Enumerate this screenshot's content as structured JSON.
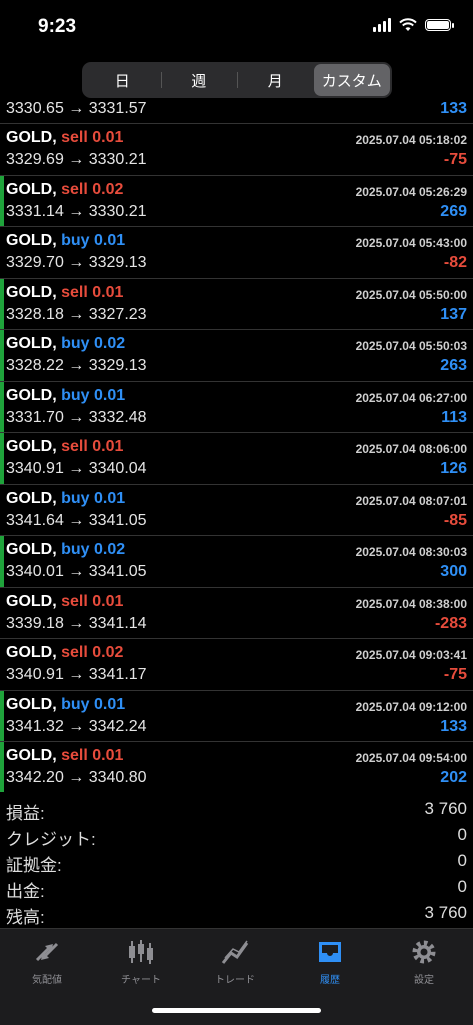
{
  "status_bar": {
    "time": "9:23"
  },
  "period_tabs": [
    {
      "label": "日",
      "active": false
    },
    {
      "label": "週",
      "active": false
    },
    {
      "label": "月",
      "active": false
    },
    {
      "label": "カスタム",
      "active": true
    }
  ],
  "trades_partial": {
    "prices": "3330.65 → 3331.57",
    "profit": "133"
  },
  "trades": [
    {
      "symbol": "GOLD,",
      "side": "sell",
      "action": "sell 0.01",
      "date": "2025.07.04 05:18:02",
      "prices": "3329.69 → 3330.21",
      "profit": "-75"
    },
    {
      "symbol": "GOLD,",
      "side": "sell",
      "action": "sell 0.02",
      "date": "2025.07.04 05:26:29",
      "prices": "3331.14 → 3330.21",
      "profit": "269"
    },
    {
      "symbol": "GOLD,",
      "side": "buy",
      "action": "buy 0.01",
      "date": "2025.07.04 05:43:00",
      "prices": "3329.70 → 3329.13",
      "profit": "-82"
    },
    {
      "symbol": "GOLD,",
      "side": "sell",
      "action": "sell 0.01",
      "date": "2025.07.04 05:50:00",
      "prices": "3328.18 → 3327.23",
      "profit": "137"
    },
    {
      "symbol": "GOLD,",
      "side": "buy",
      "action": "buy 0.02",
      "date": "2025.07.04 05:50:03",
      "prices": "3328.22 → 3329.13",
      "profit": "263"
    },
    {
      "symbol": "GOLD,",
      "side": "buy",
      "action": "buy 0.01",
      "date": "2025.07.04 06:27:00",
      "prices": "3331.70 → 3332.48",
      "profit": "113"
    },
    {
      "symbol": "GOLD,",
      "side": "sell",
      "action": "sell 0.01",
      "date": "2025.07.04 08:06:00",
      "prices": "3340.91 → 3340.04",
      "profit": "126"
    },
    {
      "symbol": "GOLD,",
      "side": "buy",
      "action": "buy 0.01",
      "date": "2025.07.04 08:07:01",
      "prices": "3341.64 → 3341.05",
      "profit": "-85"
    },
    {
      "symbol": "GOLD,",
      "side": "buy",
      "action": "buy 0.02",
      "date": "2025.07.04 08:30:03",
      "prices": "3340.01 → 3341.05",
      "profit": "300"
    },
    {
      "symbol": "GOLD,",
      "side": "sell",
      "action": "sell 0.01",
      "date": "2025.07.04 08:38:00",
      "prices": "3339.18 → 3341.14",
      "profit": "-283"
    },
    {
      "symbol": "GOLD,",
      "side": "sell",
      "action": "sell 0.02",
      "date": "2025.07.04 09:03:41",
      "prices": "3340.91 → 3341.17",
      "profit": "-75"
    },
    {
      "symbol": "GOLD,",
      "side": "buy",
      "action": "buy 0.01",
      "date": "2025.07.04 09:12:00",
      "prices": "3341.32 → 3342.24",
      "profit": "133"
    },
    {
      "symbol": "GOLD,",
      "side": "sell",
      "action": "sell 0.01",
      "date": "2025.07.04 09:54:00",
      "prices": "3342.20 → 3340.80",
      "profit": "202"
    }
  ],
  "summary": [
    {
      "label": "損益:",
      "value": "3 760"
    },
    {
      "label": "クレジット:",
      "value": "0"
    },
    {
      "label": "証拠金:",
      "value": "0"
    },
    {
      "label": "出金:",
      "value": "0"
    },
    {
      "label": "残高:",
      "value": "3 760"
    }
  ],
  "tabbar": [
    {
      "label": "気配値",
      "icon": "quotes-arrows-icon",
      "active": false
    },
    {
      "label": "チャート",
      "icon": "candlestick-chart-icon",
      "active": false
    },
    {
      "label": "トレード",
      "icon": "trade-line-icon",
      "active": false
    },
    {
      "label": "履歴",
      "icon": "history-inbox-icon",
      "active": true
    },
    {
      "label": "設定",
      "icon": "gear-icon",
      "active": false
    }
  ],
  "colors": {
    "sell": "#e74c3c",
    "buy": "#2f8ff5",
    "profit_bar": "#1fa33b",
    "active_tab": "#2f8ff5"
  }
}
